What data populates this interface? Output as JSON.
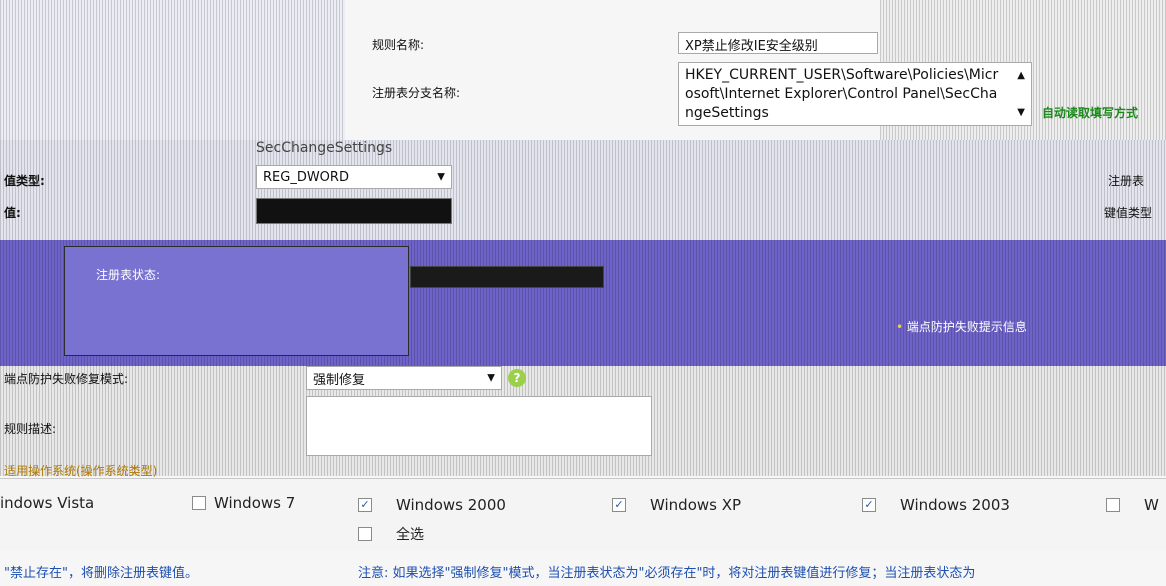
{
  "colors": {
    "band_purple": "#6d63c9",
    "link_green": "#1a8a1a",
    "note_blue": "#1c4fb0",
    "field_border": "#a9a9a9"
  },
  "form": {
    "rule_name_label": "规则名称:",
    "rule_name_value": "XP禁止修改IE安全级别",
    "reg_branch_label": "注册表分支名称:",
    "reg_branch_value": "HKEY_CURRENT_USER\\Software\\Policies\\Microsoft\\Internet Explorer\\Control Panel\\SecChangeSettings",
    "quick_method_link": "自动读取填写方式",
    "key_name_value": "SecChangeSettings",
    "value_type_label": "值类型:",
    "value_type_value": "REG_DWORD",
    "value_label": "值:",
    "reg_state_label": "注册表状态:",
    "right_label_1": "注册表",
    "right_label_2": "键值类型",
    "alert_info_label": "端点防护失败提示信息",
    "repair_mode_label": "端点防护失败修复模式:",
    "repair_mode_value": "强制修复",
    "rule_desc_label": "规则描述:",
    "rule_desc_value": "",
    "os_section_label": "适用操作系统(操作系统类型)"
  },
  "os_list": [
    {
      "label": "indows Vista",
      "checked": null
    },
    {
      "label": "Windows 7",
      "checked": false
    },
    {
      "label": "Windows 2000",
      "checked": true
    },
    {
      "label": "Windows XP",
      "checked": true
    },
    {
      "label": "Windows 2003",
      "checked": true
    },
    {
      "label": "W",
      "checked": false
    }
  ],
  "select_all_label": "全选",
  "footer": {
    "left_note": "\"禁止存在\"，将删除注册表键值。",
    "right_note": "注意: 如果选择\"强制修复\"模式，当注册表状态为\"必须存在\"时，将对注册表键值进行修复；当注册表状态为"
  },
  "icons": {
    "dropdown": "chevron-down-icon",
    "scroll_up": "scroll-up-icon",
    "scroll_down": "scroll-down-icon",
    "help": "help-icon"
  }
}
